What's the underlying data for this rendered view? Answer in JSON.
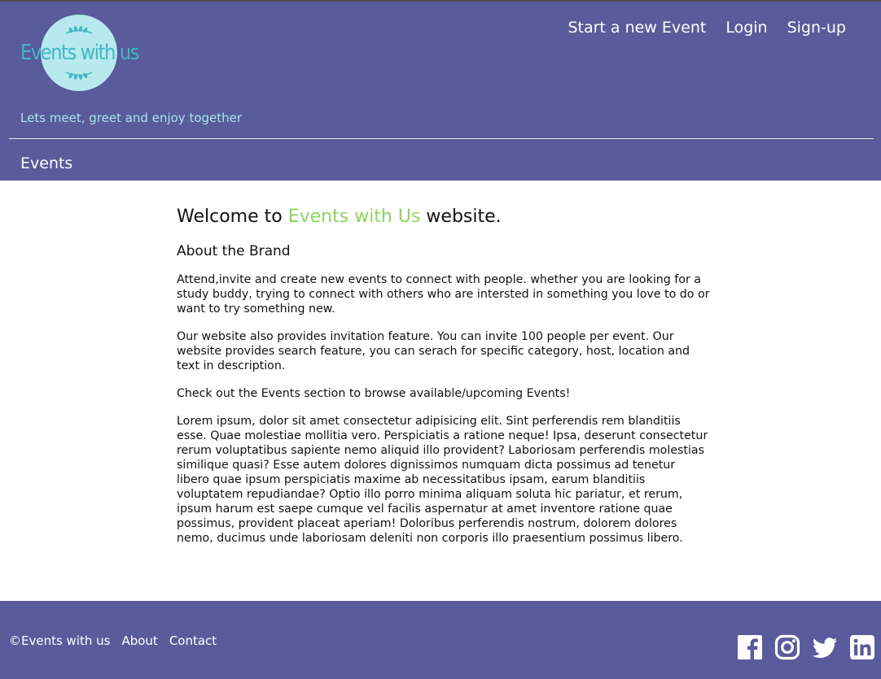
{
  "header": {
    "logo_text": "Events with us",
    "tagline": "Lets meet, greet and enjoy together",
    "nav": {
      "start_event": "Start a new Event",
      "login": "Login",
      "signup": "Sign-up"
    },
    "events_link": "Events"
  },
  "main": {
    "welcome_prefix": "Welcome to ",
    "welcome_brand": "Events with Us",
    "welcome_suffix": " website.",
    "about_heading": "About the Brand",
    "paragraphs": [
      "Attend,invite and create new events to connect with people. whether you are looking for a study buddy, trying to connect with others who are intersted in something you love to do or want to try something new.",
      "Our website also provides invitation feature. You can invite 100 people per event. Our website provides search feature, you can serach for specific category, host, location and text in description.",
      "Check out the Events section to browse available/upcoming Events!",
      "Lorem ipsum, dolor sit amet consectetur adipisicing elit. Sint perferendis rem blanditiis esse. Quae molestiae mollitia vero. Perspiciatis a ratione neque! Ipsa, deserunt consectetur rerum voluptatibus sapiente nemo aliquid illo provident? Laboriosam perferendis molestias similique quasi? Esse autem dolores dignissimos numquam dicta possimus ad tenetur libero quae ipsum perspiciatis maxime ab necessitatibus ipsam, earum blanditiis voluptatem repudiandae? Optio illo porro minima aliquam soluta hic pariatur, et rerum, ipsum harum est saepe cumque vel facilis aspernatur at amet inventore ratione quae possimus, provident placeat aperiam! Doloribus perferendis nostrum, dolorem dolores nemo, ducimus unde laboriosam deleniti non corporis illo praesentium possimus libero."
    ]
  },
  "footer": {
    "copyright": "©Events with us",
    "about": "About",
    "contact": "Contact",
    "socials": [
      "facebook-icon",
      "instagram-icon",
      "twitter-icon",
      "linkedin-icon"
    ]
  },
  "colors": {
    "header_bg": "#595b9a",
    "brand_green": "#8dd35f",
    "logo_teal": "#3fb8c2",
    "logo_circle": "#b7e9ee",
    "tagline": "#a9e4f0"
  }
}
